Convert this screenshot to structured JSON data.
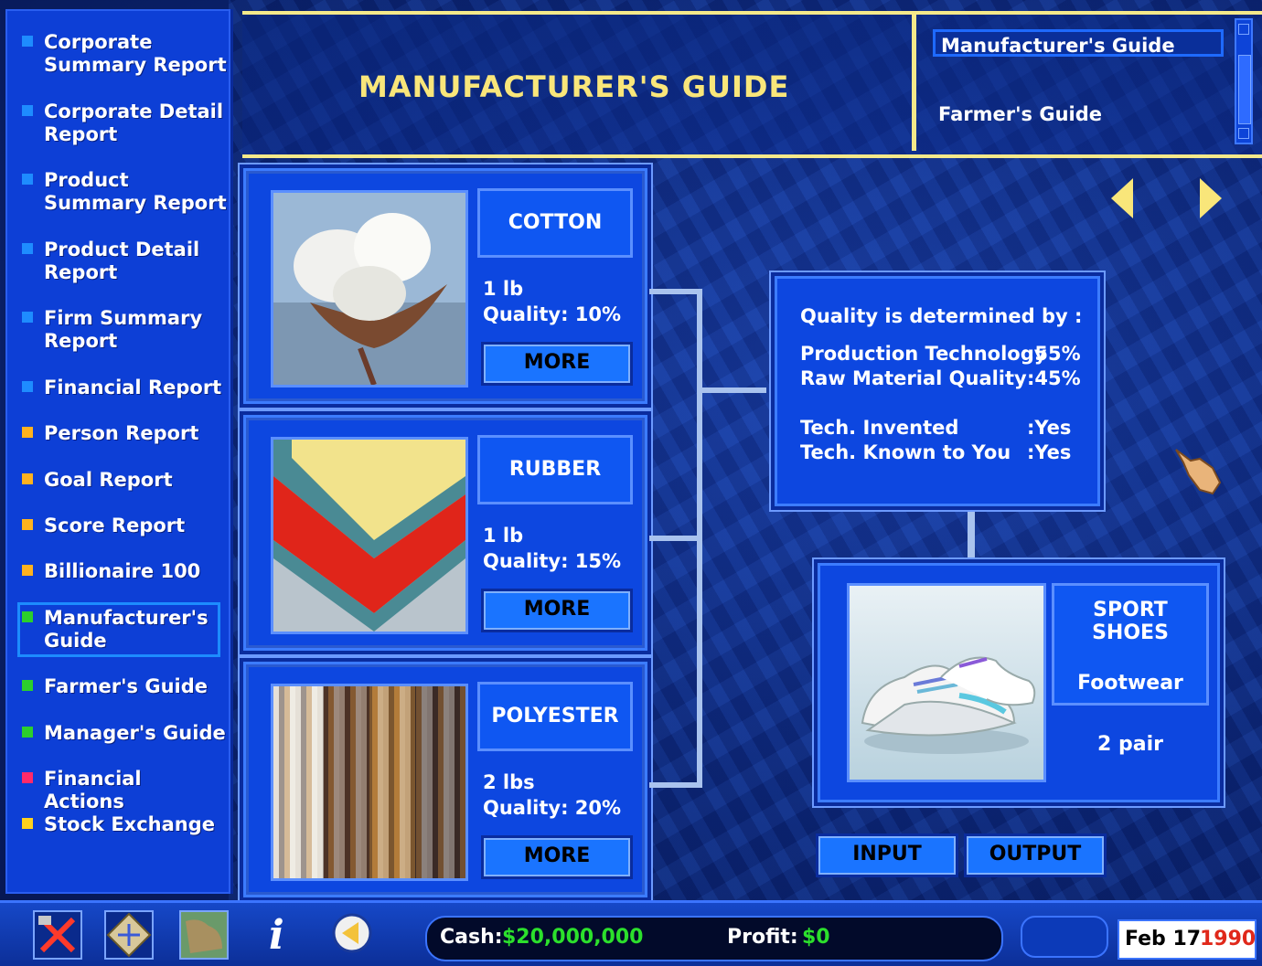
{
  "sidebar": {
    "items": [
      {
        "label": "Corporate Summary Report",
        "color": "#1e8cff"
      },
      {
        "label": "Corporate Detail Report",
        "color": "#1e8cff"
      },
      {
        "label": "Product Summary Report",
        "color": "#1e8cff"
      },
      {
        "label": "Product Detail Report",
        "color": "#1e8cff"
      },
      {
        "label": "Firm Summary Report",
        "color": "#1e8cff"
      },
      {
        "label": "Financial Report",
        "color": "#1e8cff"
      },
      {
        "label": "Person Report",
        "color": "#ffb21e"
      },
      {
        "label": "Goal Report",
        "color": "#ffb21e"
      },
      {
        "label": "Score Report",
        "color": "#ffb21e"
      },
      {
        "label": "Billionaire 100",
        "color": "#ffb21e"
      },
      {
        "label": "Manufacturer's Guide",
        "color": "#2ccf2c"
      },
      {
        "label": "Farmer's Guide",
        "color": "#2ccf2c"
      },
      {
        "label": "Manager's Guide",
        "color": "#2ccf2c"
      },
      {
        "label": "Financial Actions",
        "color": "#ff2a6a"
      },
      {
        "label": "Stock Exchange",
        "color": "#ffd21e"
      }
    ]
  },
  "header": {
    "title": "MANUFACTURER'S GUIDE",
    "guides": [
      "Manufacturer's Guide",
      "Farmer's Guide"
    ]
  },
  "inputs": [
    {
      "name": "COTTON",
      "amount": "1 lb",
      "quality": "Quality: 10%",
      "more": "MORE"
    },
    {
      "name": "RUBBER",
      "amount": "1 lb",
      "quality": "Quality: 15%",
      "more": "MORE"
    },
    {
      "name": "POLYESTER",
      "amount": "2 lbs",
      "quality": "Quality: 20%",
      "more": "MORE"
    }
  ],
  "quality_info": {
    "heading": "Quality is determined by :",
    "production_label": "Production Technology",
    "production_value": ":55%",
    "raw_label": "Raw Material Quality",
    "raw_value": ":45%",
    "invented_label": "Tech. Invented",
    "invented_value": ":Yes",
    "known_label": "Tech. Known to You",
    "known_value": ":Yes"
  },
  "output": {
    "name": "SPORT SHOES",
    "category": "Footwear",
    "quantity": "2 pair"
  },
  "buttons": {
    "input": "INPUT",
    "output": "OUTPUT"
  },
  "status": {
    "cash_label": "Cash:",
    "cash_value": "$20,000,000",
    "profit_label": "Profit:",
    "profit_value": "$0",
    "value_color": "#2ce02c"
  },
  "date": {
    "day": "Feb 17",
    "year": "1990"
  }
}
